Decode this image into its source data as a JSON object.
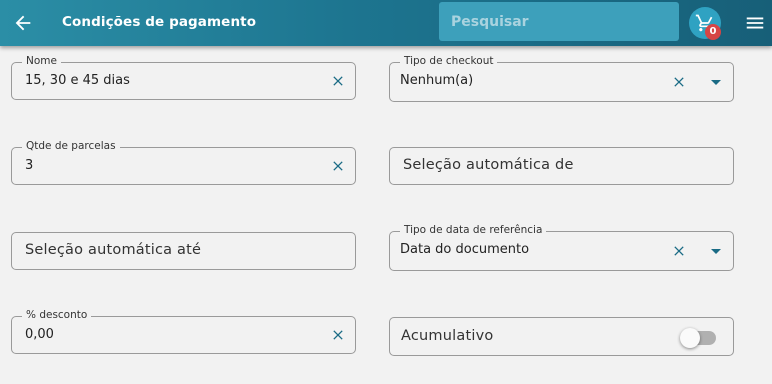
{
  "header": {
    "title": "Condições de pagamento",
    "back_icon": "arrow-left-icon",
    "search_placeholder": "Pesquisar",
    "cart_icon": "cart-icon",
    "cart_count": "0",
    "menu_icon": "hamburger-menu-icon"
  },
  "form": {
    "nome": {
      "label": "Nome",
      "value": "15, 30 e 45 dias"
    },
    "tipo_checkout": {
      "label": "Tipo de checkout",
      "value": "Nenhum(a)"
    },
    "qtde_parcelas": {
      "label": "Qtde de parcelas",
      "value": "3"
    },
    "selecao_de": {
      "placeholder": "Seleção automática de"
    },
    "selecao_ate": {
      "placeholder": "Seleção automática até"
    },
    "tipo_data": {
      "label": "Tipo de data de referência",
      "value": "Data do documento"
    },
    "desconto": {
      "label": "% desconto",
      "value": "0,00"
    },
    "acumulativo": {
      "label": "Acumulativo",
      "checked": false
    }
  },
  "colors": {
    "appbar": "#1d7590",
    "accent": "#1a6b85",
    "badge": "#d64545"
  }
}
